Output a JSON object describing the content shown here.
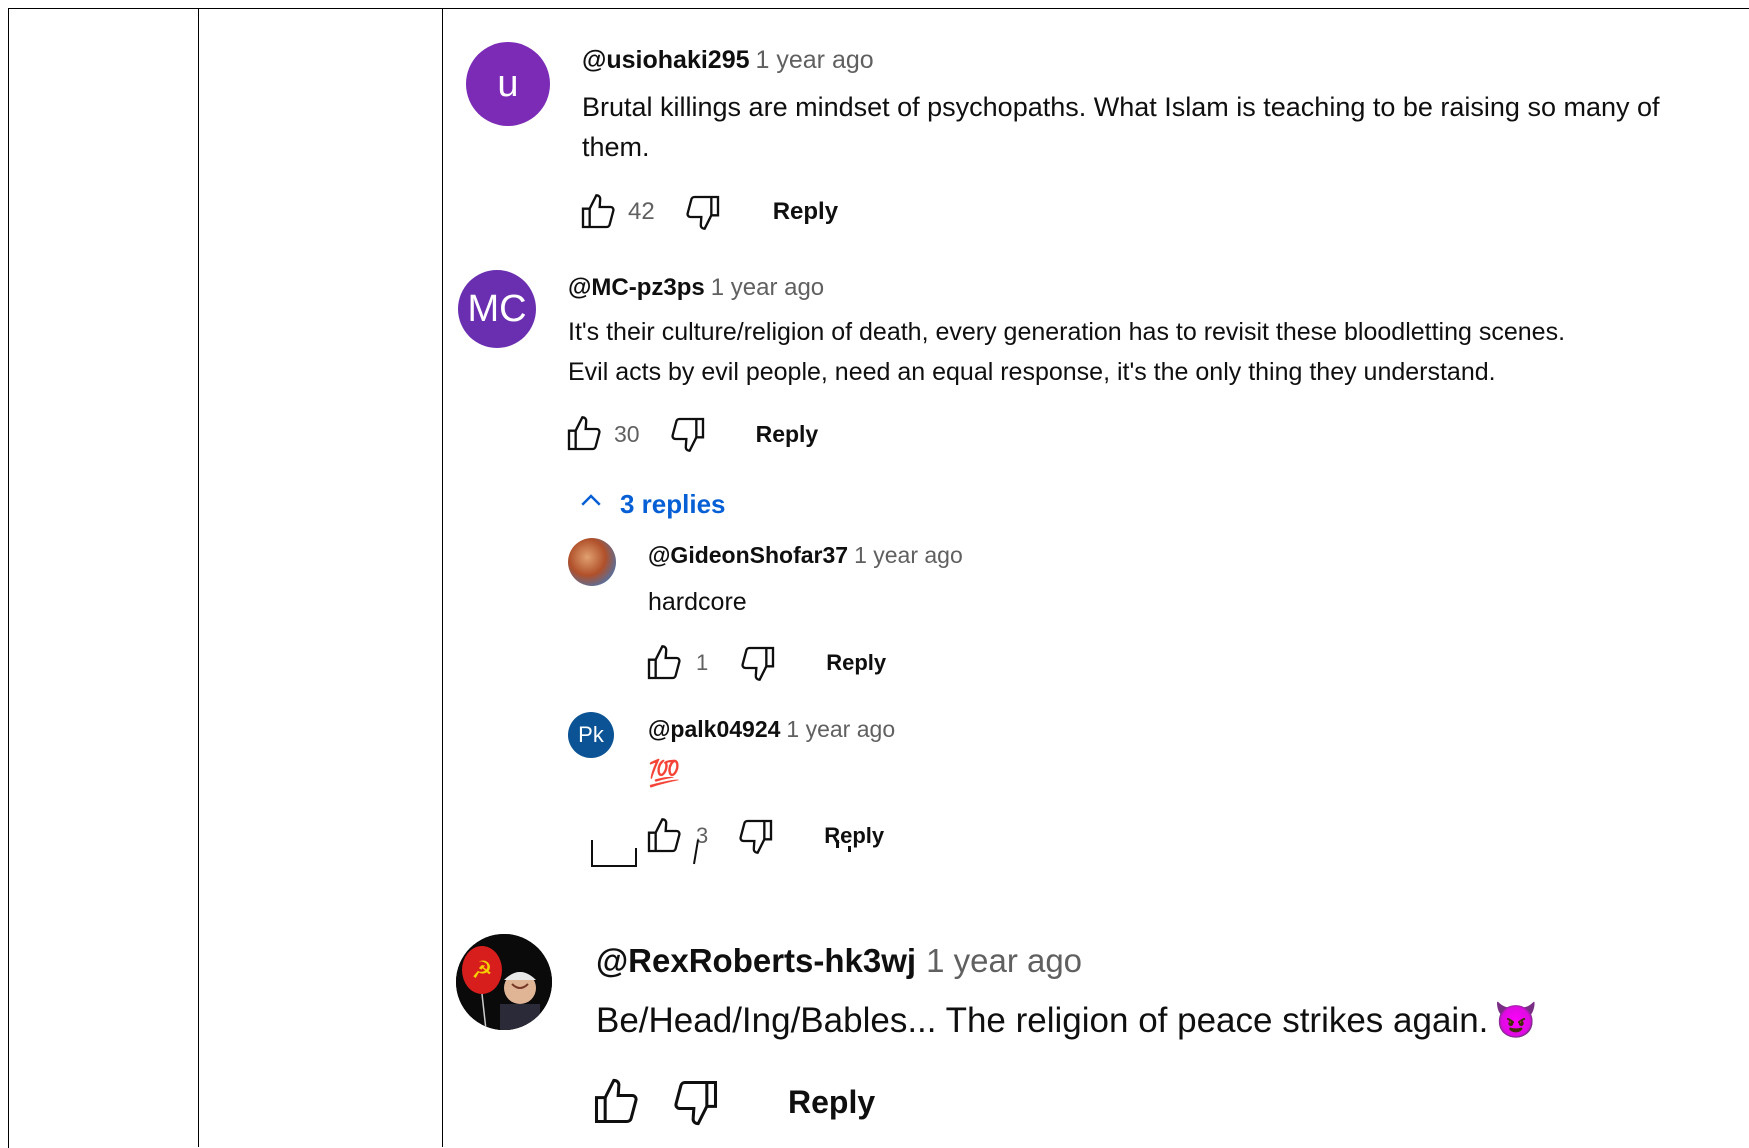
{
  "comments": [
    {
      "avatar_letter": "u",
      "avatar_color": "#7b2bb5",
      "handle": "@usiohaki295",
      "time": "1 year ago",
      "text_line1": "Brutal killings are mindset of psychopaths. What Islam is teaching to be raising so many of",
      "text_line2": "them.",
      "likes": "42",
      "reply_label": "Reply"
    },
    {
      "avatar_letter": "MC",
      "avatar_color": "#6a2fb0",
      "handle": "@MC-pz3ps",
      "time": "1 year ago",
      "text_line1": "It's their culture/religion of death, every generation has to revisit these bloodletting scenes.",
      "text_line2": "Evil acts by evil people, need an equal response, it's the only thing they understand.",
      "likes": "30",
      "reply_label": "Reply",
      "replies_toggle": "3 replies",
      "replies": [
        {
          "handle": "@GideonShofar37",
          "time": "1 year ago",
          "text": "hardcore",
          "likes": "1",
          "reply_label": "Reply"
        },
        {
          "avatar_letter": "Pk",
          "avatar_color": "#0b5394",
          "handle": "@palk04924",
          "time": "1 year ago",
          "text": "💯",
          "likes": "3",
          "reply_label": "Reply"
        }
      ]
    },
    {
      "handle": "@RexRoberts-hk3wj",
      "time": "1 year ago",
      "text": "Be/Head/Ing/Bables... The religion of peace strikes again.",
      "emoji": "😈",
      "reply_label": "Reply"
    }
  ],
  "icons": {
    "like": "thumbs-up-icon",
    "dislike": "thumbs-down-icon",
    "collapse": "chevron-up-icon"
  }
}
